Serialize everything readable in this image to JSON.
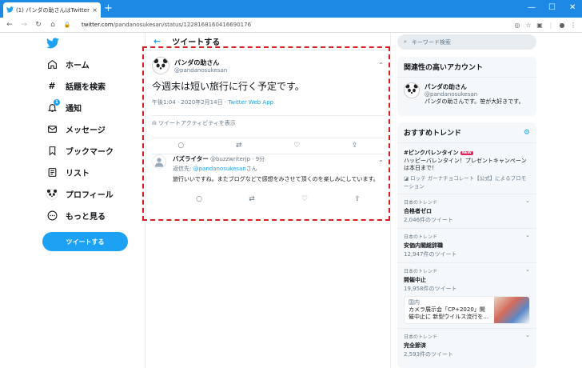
{
  "browser": {
    "tab_title": "(1) パンダの助さんはTwitterを使",
    "tab_close": "×",
    "new_tab": "+",
    "url_host": "twitter.com",
    "url_path": "/pandanosukesan/status/1228168160416690176",
    "window_controls": [
      "—",
      "☐",
      "✕"
    ]
  },
  "sidebar": {
    "items": [
      {
        "label": "ホーム",
        "icon": "home-icon"
      },
      {
        "label": "話題を検索",
        "icon": "hashtag-icon"
      },
      {
        "label": "通知",
        "icon": "bell-icon",
        "badge": "1"
      },
      {
        "label": "メッセージ",
        "icon": "mail-icon"
      },
      {
        "label": "ブックマーク",
        "icon": "bookmark-icon"
      },
      {
        "label": "リスト",
        "icon": "list-icon"
      },
      {
        "label": "プロフィール",
        "icon": "profile-avatar-icon"
      },
      {
        "label": "もっと見る",
        "icon": "more-icon"
      }
    ],
    "tweet_button": "ツイートする"
  },
  "main": {
    "header_title": "ツイートする",
    "tweet": {
      "name": "パンダの助さん",
      "handle": "@pandanosukesan",
      "text": "今週末は短い旅行に行く予定です。",
      "timestamp": "午後1:04 · 2020年2月14日 · ",
      "source": "Twitter Web App",
      "activity": "ツイートアクティビティを表示"
    },
    "reply": {
      "name": "バズライター",
      "handle": "@buzzwriterjp · 9分",
      "to_prefix": "返信先: ",
      "to_handle": "@pandanosukesan",
      "to_suffix": "さん",
      "text": "旅行いいですね。またブログなどで感想をみさせて頂くのを楽しみにしています。"
    }
  },
  "right": {
    "search_placeholder": "キーワード検索",
    "related_title": "関連性の高いアカウント",
    "account": {
      "name": "パンダの助さん",
      "handle": "@pandanosukesan",
      "bio": "パンダの助さんです。笹が大好きです。"
    },
    "trends_title": "おすすめトレンド",
    "promoted": {
      "tag": "#ピンクバレンタイン",
      "badge": "NEW",
      "desc": "ハッピーバレンタイン！プレゼントキャンペーンは本日まで！",
      "promo": "ロッテ ガーナチョコレート【公式】によるプロモーション"
    },
    "trends": [
      {
        "ctx": "日本のトレンド",
        "name": "合格者ゼロ",
        "count": "2,046件のツイート"
      },
      {
        "ctx": "日本のトレンド",
        "name": "安価内閣総辞職",
        "count": "12,947件のツイート"
      },
      {
        "ctx": "日本のトレンド",
        "name": "開催中止",
        "count": "19,958件のツイート"
      },
      {
        "ctx": "日本のトレンド",
        "name": "完全節済",
        "count": "2,593件のツイート"
      }
    ],
    "news": {
      "src": "国内",
      "text": "カメラ展示会「CP+2020」開催中止に 新型ウイルス流行を…"
    }
  }
}
